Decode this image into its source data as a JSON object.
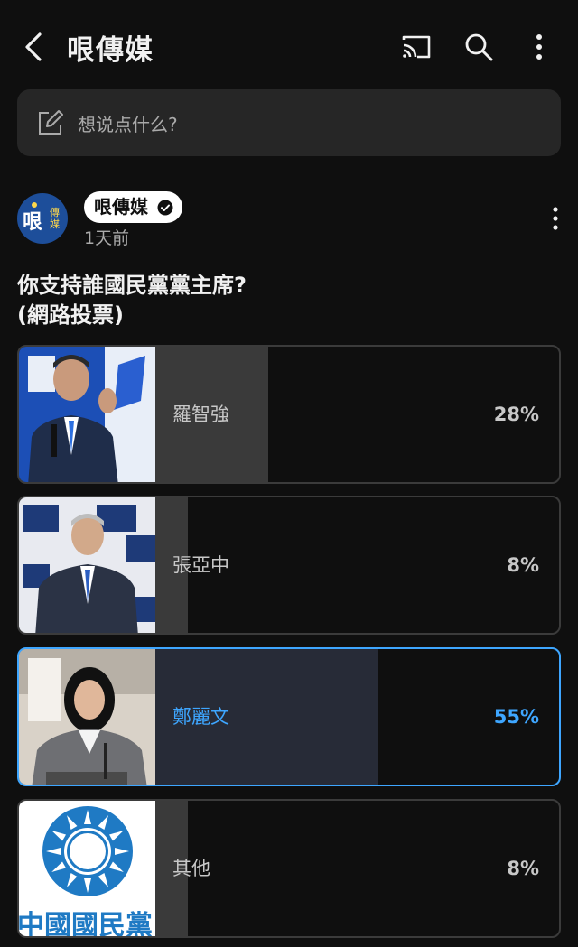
{
  "header": {
    "title": "哏傳媒",
    "back_icon": "chevron-left-icon",
    "cast_icon": "cast-icon",
    "search_icon": "search-icon",
    "more_icon": "more-vertical-icon"
  },
  "compose": {
    "placeholder": "想说点什么?",
    "icon": "edit-icon"
  },
  "post": {
    "channel_name": "哏傳媒",
    "verified_icon": "verified-check-icon",
    "time": "1天前",
    "question_line1": "你支持誰國民黨黨主席?",
    "question_line2": "(網路投票)"
  },
  "poll": {
    "options": [
      {
        "label": "羅智強",
        "percent_text": "28%",
        "percent": 28,
        "selected": false,
        "image": "candidate-photo"
      },
      {
        "label": "張亞中",
        "percent_text": "8%",
        "percent": 8,
        "selected": false,
        "image": "candidate-photo"
      },
      {
        "label": "鄭麗文",
        "percent_text": "55%",
        "percent": 55,
        "selected": true,
        "image": "candidate-photo"
      },
      {
        "label": "其他",
        "percent_text": "8%",
        "percent": 8,
        "selected": false,
        "image": "kmt-emblem"
      }
    ]
  },
  "avatar": {
    "logo_main": "哏",
    "logo_side": "傳媒"
  },
  "emblem": {
    "caption": "中國國民黨"
  },
  "colors": {
    "background": "#0f0f0f",
    "accent": "#3ea6ff",
    "bar": "#3a3a3a",
    "selected_bar": "#272b37"
  }
}
